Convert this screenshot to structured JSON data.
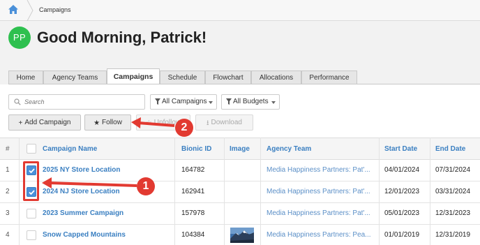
{
  "breadcrumb": {
    "current": "Campaigns"
  },
  "user": {
    "initials": "PP",
    "greeting": "Good Morning, Patrick!"
  },
  "tabs": [
    {
      "label": "Home"
    },
    {
      "label": "Agency Teams"
    },
    {
      "label": "Campaigns",
      "active": true
    },
    {
      "label": "Schedule"
    },
    {
      "label": "Flowchart"
    },
    {
      "label": "Allocations"
    },
    {
      "label": "Performance"
    }
  ],
  "filters": {
    "search_placeholder": "Search",
    "campaigns_filter": "All Campaigns",
    "budgets_filter": "All Budgets"
  },
  "toolbar": {
    "add_campaign": "Add Campaign",
    "follow": "Follow",
    "unfollow": "Unfollow",
    "download": "Download"
  },
  "table": {
    "headers": {
      "num": "#",
      "campaign_name": "Campaign Name",
      "bionic_id": "Bionic ID",
      "image": "Image",
      "agency_team": "Agency Team",
      "start_date": "Start Date",
      "end_date": "End Date"
    },
    "rows": [
      {
        "num": "1",
        "name": "2025 NY Store Location",
        "bionic_id": "164782",
        "agency": "Media Happiness Partners: Pat'...",
        "start": "04/01/2024",
        "end": "07/31/2024",
        "checked": true
      },
      {
        "num": "2",
        "name": "2024 NJ Store Location",
        "bionic_id": "162941",
        "agency": "Media Happiness Partners: Pat'...",
        "start": "12/01/2023",
        "end": "03/31/2024",
        "checked": true
      },
      {
        "num": "3",
        "name": "2023 Summer Campaign",
        "bionic_id": "157978",
        "agency": "Media Happiness Partners: Pat'...",
        "start": "05/01/2023",
        "end": "12/31/2023",
        "checked": false
      },
      {
        "num": "4",
        "name": "Snow Capped Mountains",
        "bionic_id": "104384",
        "agency": "Media Happiness Partners: Pea...",
        "start": "01/01/2019",
        "end": "12/31/2019",
        "checked": false,
        "image": "mountain-thumbnail"
      }
    ]
  },
  "annotations": {
    "step1": "1",
    "step2": "2"
  },
  "colors": {
    "accent": "#3a7fc1",
    "avatar": "#2ec04f",
    "annotation": "#e23a31",
    "checkbox": "#4a90d9"
  }
}
